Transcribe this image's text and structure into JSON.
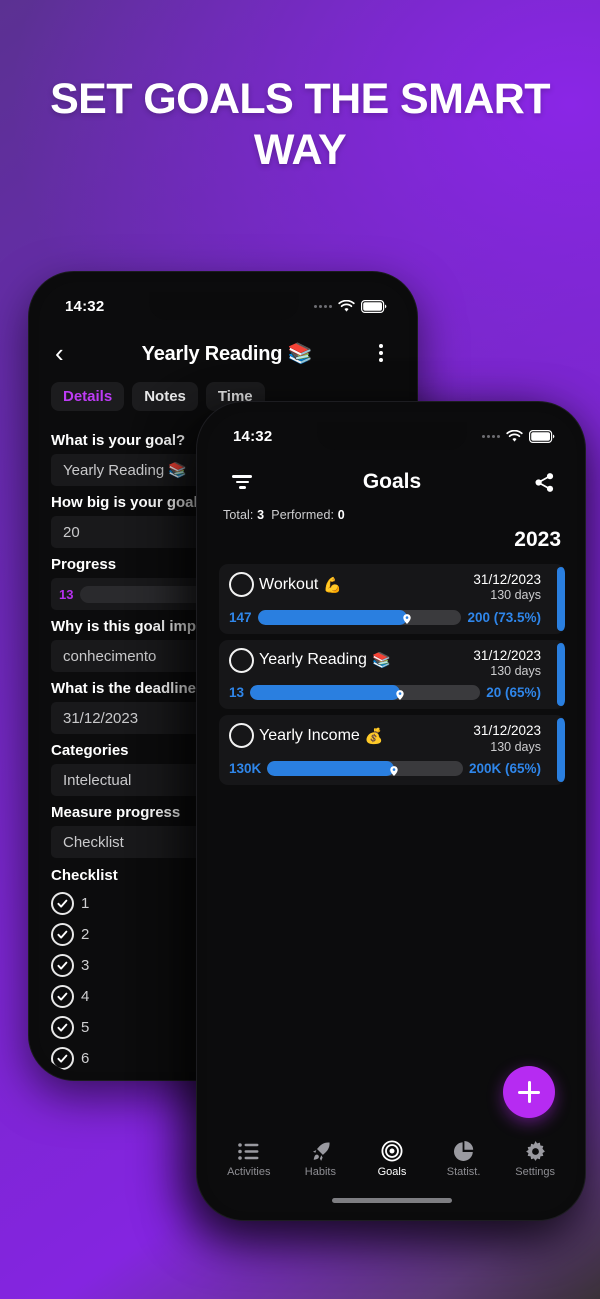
{
  "headline": "SET GOALS THE SMART WAY",
  "theme": {
    "bg_gradient_start": "#5b3192",
    "bg_gradient_mid": "#8425e0",
    "bg_gradient_end": "#3a3138",
    "accent_purple": "#b62bf2",
    "accent_blue": "#2a7fe0",
    "screen_bg": "#0c0c0d"
  },
  "back_phone": {
    "status": {
      "time": "14:32",
      "wifi_icon": "wifi-icon",
      "battery_icon": "battery-icon",
      "signal_icon": "signal-dots-icon"
    },
    "header": {
      "back_icon": "chevron-left-icon",
      "title": "Yearly Reading 📚",
      "menu_icon": "kebab-menu-icon"
    },
    "tabs": [
      {
        "label": "Details",
        "active": true
      },
      {
        "label": "Notes",
        "active": false
      },
      {
        "label": "Time",
        "active": false
      }
    ],
    "fields": [
      {
        "label": "What is your goal?",
        "value": "Yearly Reading 📚"
      },
      {
        "label": "How big is your goal?",
        "value": "20"
      }
    ],
    "progress": {
      "label": "Progress",
      "value": "13",
      "percent": 65
    },
    "fields2": [
      {
        "label": "Why is this goal important?",
        "value": "conhecimento"
      },
      {
        "label": "What is the deadline?",
        "value": "31/12/2023"
      },
      {
        "label": "Categories",
        "value": "Intelectual"
      },
      {
        "label": "Measure progress",
        "value": "Checklist"
      }
    ],
    "checklist_title": "Checklist",
    "checklist": [
      {
        "label": "1",
        "checked": true
      },
      {
        "label": "2",
        "checked": true
      },
      {
        "label": "3",
        "checked": true
      },
      {
        "label": "4",
        "checked": true
      },
      {
        "label": "5",
        "checked": true
      },
      {
        "label": "6",
        "checked": true
      }
    ]
  },
  "front_phone": {
    "status": {
      "time": "14:32",
      "wifi_icon": "wifi-icon",
      "battery_icon": "battery-icon",
      "signal_icon": "signal-dots-icon"
    },
    "header": {
      "filter_icon": "filter-icon",
      "title": "Goals",
      "share_icon": "share-icon"
    },
    "stats": {
      "total_label": "Total:",
      "total_value": "3",
      "performed_label": "Performed:",
      "performed_value": "0"
    },
    "year": "2023",
    "goals": [
      {
        "name": "Workout",
        "emoji": "💪",
        "date": "31/12/2023",
        "days": "130 days",
        "start": "147",
        "end": "200 (73.5%)",
        "percent": 73.5
      },
      {
        "name": "Yearly Reading",
        "emoji": "📚",
        "date": "31/12/2023",
        "days": "130 days",
        "start": "13",
        "end": "20 (65%)",
        "percent": 65
      },
      {
        "name": "Yearly Income",
        "emoji": "💰",
        "date": "31/12/2023",
        "days": "130 days",
        "start": "130K",
        "end": "200K (65%)",
        "percent": 65
      }
    ],
    "fab": {
      "icon": "plus-icon"
    },
    "tabbar": [
      {
        "label": "Activities",
        "icon": "list-icon",
        "active": false
      },
      {
        "label": "Habits",
        "icon": "rocket-icon",
        "active": false
      },
      {
        "label": "Goals",
        "icon": "target-icon",
        "active": true
      },
      {
        "label": "Statist.",
        "icon": "pie-chart-icon",
        "active": false
      },
      {
        "label": "Settings",
        "icon": "gear-icon",
        "active": false
      }
    ]
  }
}
